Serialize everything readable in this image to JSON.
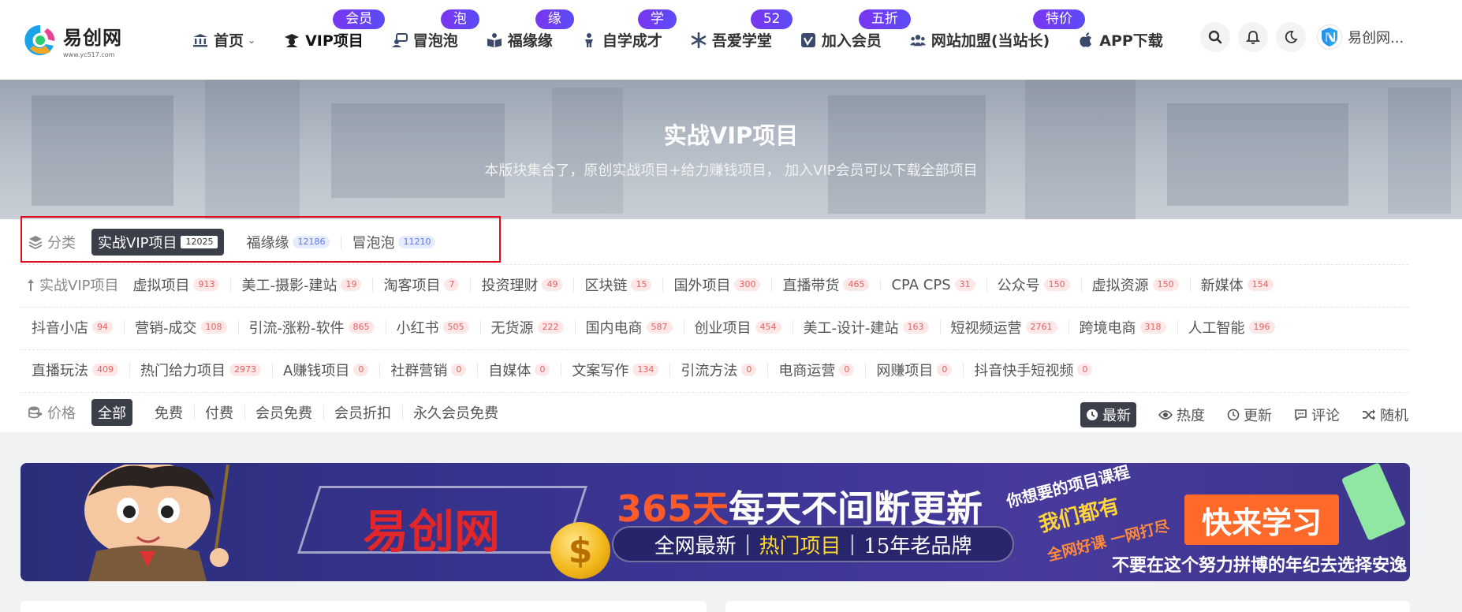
{
  "header": {
    "logo": {
      "name": "易创网",
      "url": "www.yc517.com"
    },
    "nav": [
      {
        "label": "首页",
        "icon": "bank-icon",
        "badge": "",
        "caret": "⌄"
      },
      {
        "label": "VIP项目",
        "icon": "graduate-icon",
        "badge": "会员"
      },
      {
        "label": "冒泡泡",
        "icon": "chat-user-icon",
        "badge": "泡"
      },
      {
        "label": "福缘缘",
        "icon": "book-open-icon",
        "badge": "缘"
      },
      {
        "label": "自学成才",
        "icon": "child-icon",
        "badge": "学"
      },
      {
        "label": "吾爱学堂",
        "icon": "asterisk-icon",
        "badge": "52"
      },
      {
        "label": "加入会员",
        "icon": "vimeo-icon",
        "badge": "五折"
      },
      {
        "label": "网站加盟(当站长)",
        "icon": "users-icon",
        "badge": "特价"
      },
      {
        "label": "APP下载",
        "icon": "apple-icon",
        "badge": ""
      }
    ],
    "user_name": "易创网..."
  },
  "banner": {
    "title": "实战VIP项目",
    "subtitle": "本版块集合了，原创实战项目+给力赚钱项目， 加入VIP会员可以下载全部项目"
  },
  "filter": {
    "category_label": "分类",
    "categories": [
      {
        "label": "实战VIP项目",
        "count": "12025"
      },
      {
        "label": "福缘缘",
        "count": "12186"
      },
      {
        "label": "冒泡泡",
        "count": "11210"
      }
    ],
    "subcat_parent": "实战VIP项目",
    "subcats_row1": [
      {
        "label": "虚拟项目",
        "count": "913"
      },
      {
        "label": "美工-摄影-建站",
        "count": "19"
      },
      {
        "label": "淘客项目",
        "count": "7"
      },
      {
        "label": "投资理财",
        "count": "49"
      },
      {
        "label": "区块链",
        "count": "15"
      },
      {
        "label": "国外项目",
        "count": "300"
      },
      {
        "label": "直播带货",
        "count": "465"
      },
      {
        "label": "CPA CPS",
        "count": "31"
      },
      {
        "label": "公众号",
        "count": "150"
      },
      {
        "label": "虚拟资源",
        "count": "150"
      },
      {
        "label": "新媒体",
        "count": "154"
      }
    ],
    "subcats_row2": [
      {
        "label": "抖音小店",
        "count": "94"
      },
      {
        "label": "营销-成交",
        "count": "108"
      },
      {
        "label": "引流-涨粉-软件",
        "count": "865"
      },
      {
        "label": "小红书",
        "count": "505"
      },
      {
        "label": "无货源",
        "count": "222"
      },
      {
        "label": "国内电商",
        "count": "587"
      },
      {
        "label": "创业项目",
        "count": "454"
      },
      {
        "label": "美工-设计-建站",
        "count": "163"
      },
      {
        "label": "短视频运营",
        "count": "2761"
      },
      {
        "label": "跨境电商",
        "count": "318"
      },
      {
        "label": "人工智能",
        "count": "196"
      }
    ],
    "subcats_row3": [
      {
        "label": "直播玩法",
        "count": "409"
      },
      {
        "label": "热门给力项目",
        "count": "2973"
      },
      {
        "label": "A赚钱项目",
        "count": "0"
      },
      {
        "label": "社群营销",
        "count": "0"
      },
      {
        "label": "自媒体",
        "count": "0"
      },
      {
        "label": "文案写作",
        "count": "134"
      },
      {
        "label": "引流方法",
        "count": "0"
      },
      {
        "label": "电商运营",
        "count": "0"
      },
      {
        "label": "网赚项目",
        "count": "0"
      },
      {
        "label": "抖音快手短视频",
        "count": "0"
      }
    ],
    "price_label": "价格",
    "prices": [
      "全部",
      "免费",
      "付费",
      "会员免费",
      "会员折扣",
      "永久会员免费"
    ],
    "sorts": [
      "最新",
      "热度",
      "更新",
      "评论",
      "随机"
    ]
  },
  "ad": {
    "brand": "易创网",
    "headline_red": "365天",
    "headline_white": "每天不间断更新",
    "strip_a": "全网最新",
    "strip_b": "热门项目",
    "strip_c": "15年老品牌",
    "side1": "你想要的项目课程",
    "side2": "我们都有",
    "side3": "全网好课 一网打尽",
    "cta": "快来学习",
    "footer": "不要在这个努力拼博的年纪去选择安逸"
  },
  "colors": {
    "badge_gradient": "#7a35f0",
    "active_tag_bg": "#3a3f4a",
    "highlight_box": "#e10d1c",
    "count_red_bg": "#fde7e7",
    "count_blue_bg": "#e6ecfd"
  }
}
